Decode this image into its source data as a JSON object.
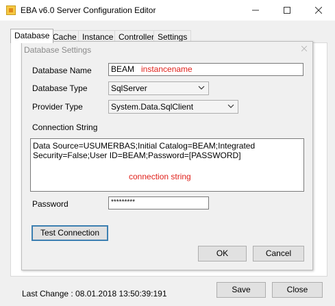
{
  "window": {
    "title": "EBA v6.0 Server Configuration Editor"
  },
  "tabs": [
    "Database",
    "Cache",
    "Instance",
    "Controller",
    "Settings"
  ],
  "dialog": {
    "title": "Database Settings",
    "database_name_label": "Database Name",
    "database_name_value": "BEAM",
    "database_name_annotation": "instancename",
    "database_type_label": "Database Type",
    "database_type_value": "SqlServer",
    "provider_type_label": "Provider Type",
    "provider_type_value": "System.Data.SqlClient",
    "connection_string_label": "Connection String",
    "connection_string_value": "Data Source=USUMERBAS;Initial Catalog=BEAM;Integrated Security=False;User ID=BEAM;Password=[PASSWORD]",
    "connection_string_annotation": "connection string",
    "password_label": "Password",
    "password_value": "*********",
    "test_connection_label": "Test Connection",
    "ok_label": "OK",
    "cancel_label": "Cancel"
  },
  "footer": {
    "last_change": "Last Change : 08.01.2018 13:50:39:191",
    "save_label": "Save",
    "close_label": "Close"
  },
  "colors": {
    "annotation": "#e0211b",
    "focus_border": "#3c7fb1"
  }
}
